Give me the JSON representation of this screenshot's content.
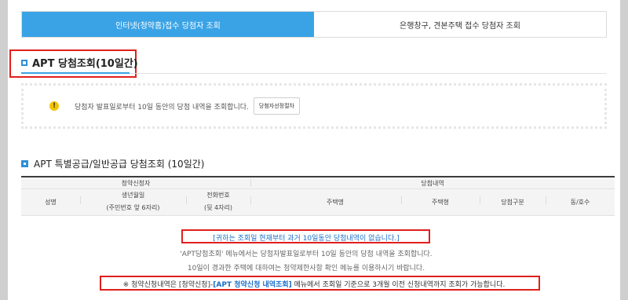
{
  "tabs": [
    {
      "label": "인터넷(청약홈)접수 당첨자 조회",
      "active": true
    },
    {
      "label": "은행창구, 견본주택 접수 당첨자 조회",
      "active": false
    }
  ],
  "section1": {
    "title": "APT 당첨조회(10일간)"
  },
  "notice": {
    "icon": "exclamation-icon",
    "text": "당첨자 발표일로부터 10일 동안의 당첨 내역을 조회합니다.",
    "button_label": "당첨자선정절차"
  },
  "section2": {
    "title": "APT 특별공급/일반공급 당첨조회 (10일간)"
  },
  "table": {
    "group_applicant": "청약신청자",
    "group_result": "당첨내역",
    "col_name": "성명",
    "col_birth": "생년월일",
    "col_birth_sub": "(주민번호 앞 6자리)",
    "col_phone": "전화번호",
    "col_phone_sub": "(뒷 4자리)",
    "col_house": "주택명",
    "col_type": "주택형",
    "col_win_type": "당첨구분",
    "col_unit": "동/호수"
  },
  "messages": {
    "no_result": "[귀하는 조회일 현재부터 과거 10일동안 당첨내역이 없습니다.]",
    "line1": "'APT당첨조회' 메뉴에서는 당첨자발표일로부터 10일 동안의 당첨 내역을 조회합니다.",
    "line2": "10일이 경과한 주택에 대하여는 청약제한사항 확인 메뉴를 이용하시기 바랍니다.",
    "note_prefix": "※",
    "note_part1": "청약신청내역은 [청약신청]-",
    "note_link": "[APT 청약신청 내역조회]",
    "note_part2": " 메뉴에서 조회일 기준으로 3개월 이전 신청내역까지 조회가 가능합니다."
  },
  "colors": {
    "accent": "#3aa3e6",
    "highlight_border": "#e0201c",
    "link": "#1a6fc9"
  }
}
